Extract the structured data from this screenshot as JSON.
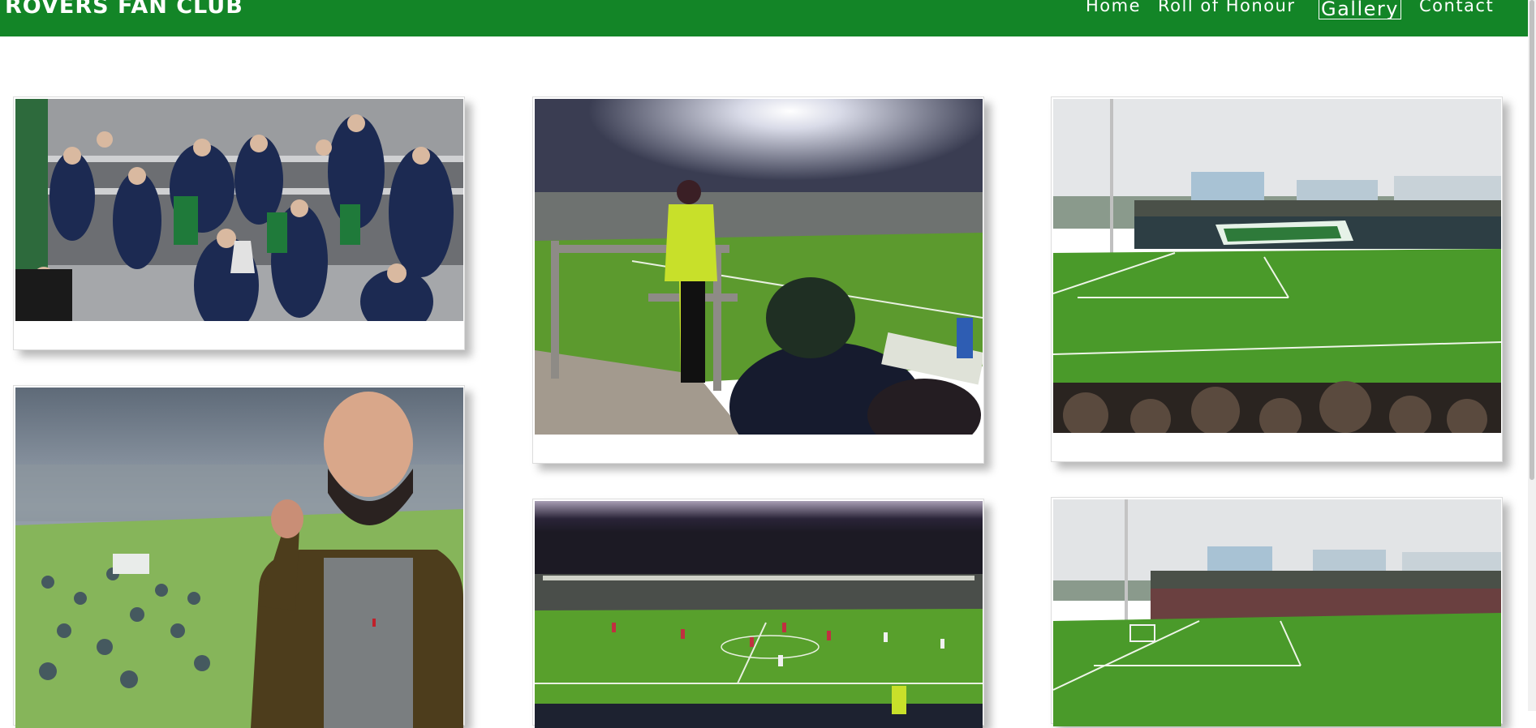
{
  "site": {
    "brand": "ROVERS FAN CLUB"
  },
  "nav": {
    "home": "Home",
    "roll": "Roll of Honour",
    "gallery": "Gallery",
    "contact": "Contact",
    "active": "Gallery"
  },
  "colors": {
    "brand_green": "#138527",
    "nav_text": "#ffffff",
    "page_bg": "#ffffff"
  },
  "gallery": {
    "photos": [
      {
        "name": "trophy-celebration-photo",
        "subject": "players in suits celebrating with trophy"
      },
      {
        "name": "stadium-night-steward-photo",
        "subject": "steward watching night match under floodlights"
      },
      {
        "name": "tallaght-stadium-day-photo",
        "subject": "stadium with large green and white flag"
      },
      {
        "name": "fan-selfie-photo",
        "subject": "bearded fan with raised fist in stadium"
      },
      {
        "name": "night-match-pitch-photo",
        "subject": "night match view of pitch"
      },
      {
        "name": "stadium-wide-day-photo",
        "subject": "wide day view of stadium stand"
      }
    ]
  }
}
